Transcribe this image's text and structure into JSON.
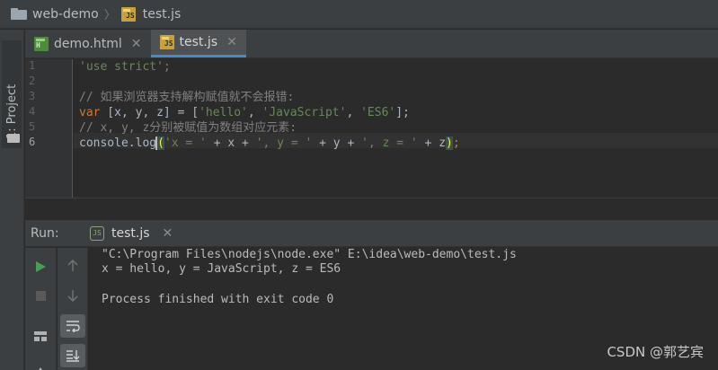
{
  "breadcrumb": {
    "project": "web-demo",
    "file": "test.js"
  },
  "sidebar": {
    "project_label": "1: Project"
  },
  "tabs": [
    {
      "label": "demo.html",
      "icon": "html-file-icon",
      "active": false
    },
    {
      "label": "test.js",
      "icon": "js-file-icon",
      "active": true
    }
  ],
  "editor": {
    "line_numbers": [
      "1",
      "2",
      "3",
      "4",
      "5",
      "6"
    ],
    "lines": {
      "l1": "'use strict';",
      "l3": "// 如果浏览器支持解构赋值就不会报错:",
      "l4_kw": "var",
      "l4_a": " [x, y, z] = [",
      "l4_s1": "'hello'",
      "l4_c1": ", ",
      "l4_s2": "'JavaScript'",
      "l4_c2": ", ",
      "l4_s3": "'ES6'",
      "l4_end": "];",
      "l5": "// x, y, z分别被赋值为数组对应元素:",
      "l6_fn": "console.log",
      "l6_open": "(",
      "l6_s1": "'x = '",
      "l6_a": " + x + ",
      "l6_s2": "', y = '",
      "l6_b": " + y + ",
      "l6_s3": "', z = '",
      "l6_c": " + z",
      "l6_close": ")",
      "l6_end": ";"
    }
  },
  "run": {
    "label": "Run:",
    "tab_label": "test.js",
    "output": [
      "\"C:\\Program Files\\nodejs\\node.exe\" E:\\idea\\web-demo\\test.js",
      "x = hello, y = JavaScript, z = ES6",
      "",
      "Process finished with exit code 0"
    ]
  },
  "watermark": "CSDN @郭艺宾",
  "colors": {
    "accent": "#4a88c7",
    "run_green": "#499c54",
    "string": "#6a8759",
    "keyword": "#cc7832",
    "comment": "#808080"
  }
}
